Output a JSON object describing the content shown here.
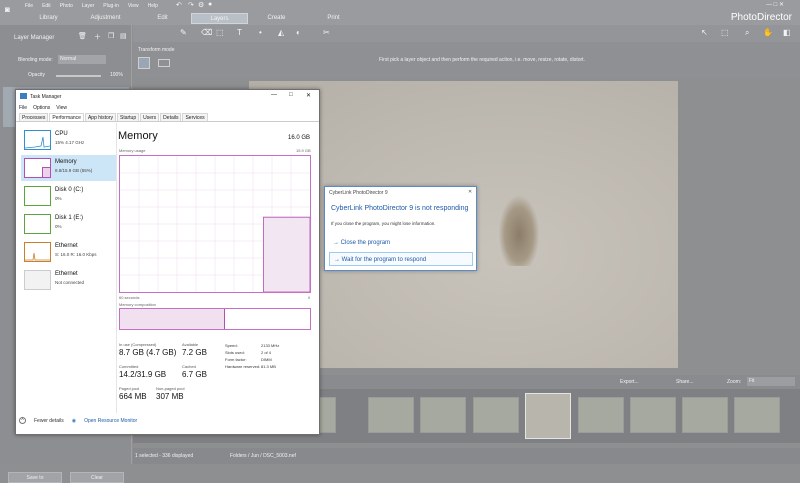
{
  "photodirector": {
    "menu": [
      "File",
      "Edit",
      "Photo",
      "Layer",
      "Plug-in",
      "View",
      "Help"
    ],
    "tabs": [
      "Library",
      "Adjustment",
      "Edit",
      "Layers",
      "Create",
      "Print"
    ],
    "active_tab": "Layers",
    "brand": "PhotoDirector",
    "layer_manager": "Layer Manager",
    "blending_mode_label": "Blending mode:",
    "blending_mode_value": "Normal",
    "opacity_label": "Opacity",
    "opacity_value": "100%",
    "transform_mode": "Transform mode",
    "hint": "First pick a layer object and then perform the required action, i.e. move, resize, rotate, distort.",
    "export": "Export...",
    "share": "Share...",
    "zoom_label": "Zoom:",
    "zoom_value": "Fit",
    "save_to": "Save to",
    "clear": "Clear",
    "status_selected": "1 selected - 336 displayed",
    "status_path": "Folders / Jun / DSC_5003.nef"
  },
  "task_manager": {
    "title": "Task Manager",
    "menu": [
      "File",
      "Options",
      "View"
    ],
    "tabs": [
      "Processes",
      "Performance",
      "App history",
      "Startup",
      "Users",
      "Details",
      "Services"
    ],
    "active_tab": "Performance",
    "resources": [
      {
        "name": "CPU",
        "sub": "15% 4.17 GHz"
      },
      {
        "name": "Memory",
        "sub": "8.8/15.9 GB (55%)"
      },
      {
        "name": "Disk 0 (C:)",
        "sub": "0%"
      },
      {
        "name": "Disk 1 (E:)",
        "sub": "0%"
      },
      {
        "name": "Ethernet",
        "sub": "S: 16.0  R: 16.0 Kbps"
      },
      {
        "name": "Ethernet",
        "sub": "Not connected"
      }
    ],
    "heading": "Memory",
    "capacity": "16.0 GB",
    "usage_label": "Memory usage",
    "usage_max": "15.9 GB",
    "axis_left": "60 seconds",
    "axis_right": "0",
    "composition_label": "Memory composition",
    "stats": {
      "in_use_label": "In use (Compressed)",
      "in_use": "8.7 GB (4.7 GB)",
      "available_label": "Available",
      "available": "7.2 GB",
      "committed_label": "Committed",
      "committed": "14.2/31.9 GB",
      "cached_label": "Cached",
      "cached": "6.7 GB",
      "paged_label": "Paged pool",
      "paged": "664 MB",
      "nonpaged_label": "Non-paged pool",
      "nonpaged": "307 MB"
    },
    "details": [
      {
        "k": "Speed:",
        "v": "2133 MHz"
      },
      {
        "k": "Slots used:",
        "v": "2 of 4"
      },
      {
        "k": "Form factor:",
        "v": "DIMM"
      },
      {
        "k": "Hardware reserved:",
        "v": "81.3 MB"
      }
    ],
    "fewer_details": "Fewer details",
    "open_monitor": "Open Resource Monitor",
    "memory_fraction": 0.55
  },
  "dialog": {
    "title": "CyberLink PhotoDirector 9",
    "heading": "CyberLink PhotoDirector 9 is not responding",
    "message": "If you close the program, you might lose information.",
    "close": "Close the program",
    "wait": "Wait for the program to respond"
  }
}
